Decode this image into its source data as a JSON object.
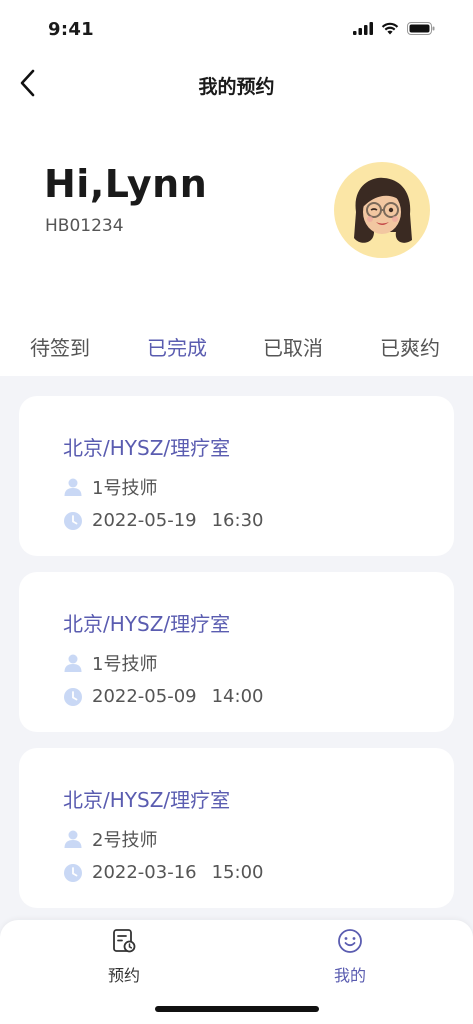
{
  "status_bar": {
    "time": "9:41",
    "icons": [
      "signal-icon",
      "wifi-icon",
      "battery-icon"
    ]
  },
  "nav": {
    "title": "我的预约",
    "back_icon": "chevron-left-icon"
  },
  "profile": {
    "greeting": "Hi,Lynn",
    "user_id": "HB01234",
    "avatar": "memoji-avatar"
  },
  "tabs": [
    {
      "label": "待签到",
      "active": false
    },
    {
      "label": "已完成",
      "active": true
    },
    {
      "label": "已取消",
      "active": false
    },
    {
      "label": "已爽约",
      "active": false
    }
  ],
  "appointments": [
    {
      "location": "北京/HYSZ/理疗室",
      "technician": "1号技师",
      "date": "2022-05-19",
      "time": "16:30"
    },
    {
      "location": "北京/HYSZ/理疗室",
      "technician": "1号技师",
      "date": "2022-05-09",
      "time": "14:00"
    },
    {
      "location": "北京/HYSZ/理疗室",
      "technician": "2号技师",
      "date": "2022-03-16",
      "time": "15:00"
    }
  ],
  "tab_bar": [
    {
      "label": "预约",
      "icon": "booking-icon",
      "active": false
    },
    {
      "label": "我的",
      "icon": "smiley-icon",
      "active": true
    }
  ],
  "colors": {
    "accent": "#5a5cb0",
    "background": "#f3f4f8",
    "icon_light": "#c9d8f5",
    "avatar_bg": "#fbe6a6"
  }
}
